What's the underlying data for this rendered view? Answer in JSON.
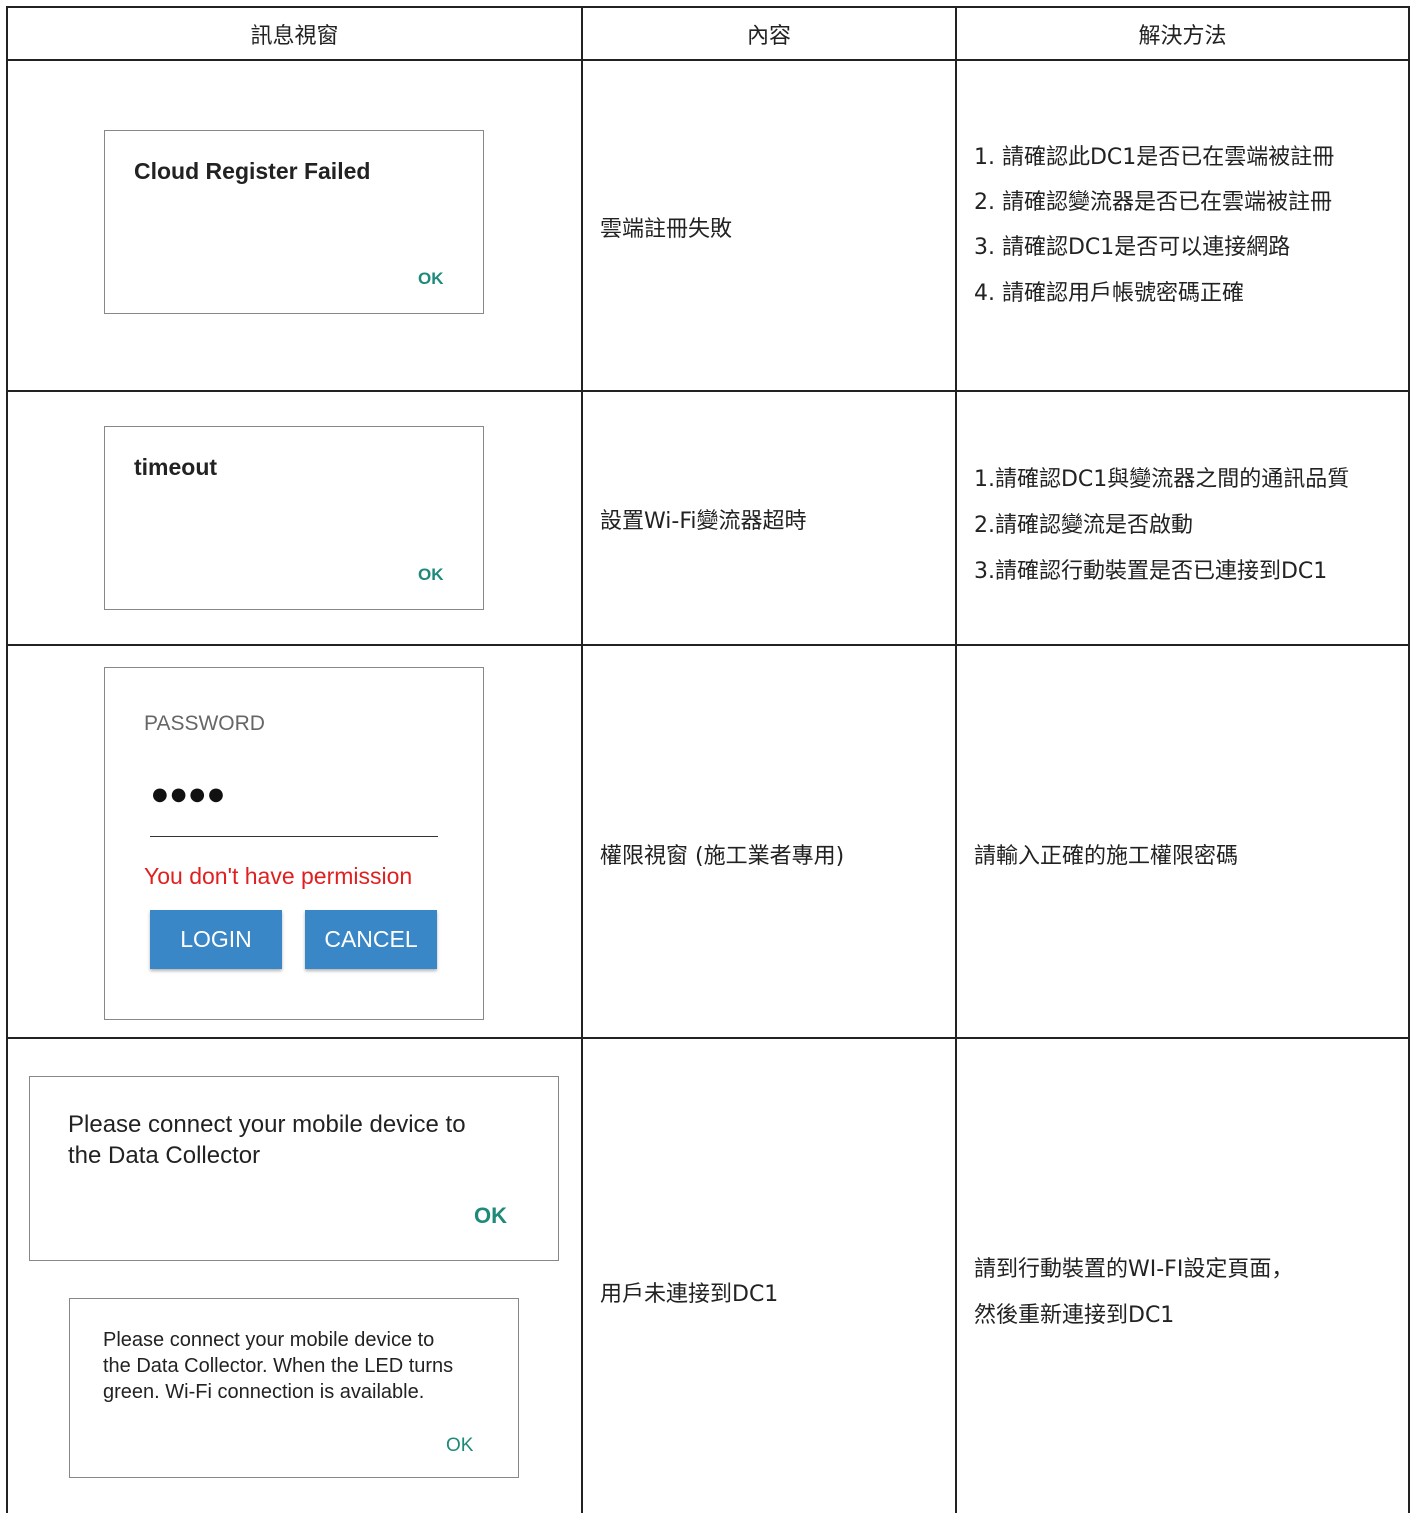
{
  "header": {
    "col1": "訊息視窗",
    "col2": "內容",
    "col3": "解決方法"
  },
  "rows": [
    {
      "dialog": {
        "title": "Cloud Register Failed",
        "ok": "OK"
      },
      "content": "雲端註冊失敗",
      "solutions": [
        "1. 請確認此DC1是否已在雲端被註冊",
        "2. 請確認變流器是否已在雲端被註冊",
        "3. 請確認DC1是否可以連接網路",
        "4. 請確認用戶帳號密碼正確"
      ]
    },
    {
      "dialog": {
        "title": "timeout",
        "ok": "OK"
      },
      "content": "設置Wi-Fi變流器超時",
      "solutions": [
        "1.請確認DC1與變流器之間的通訊品質",
        "2.請確認變流是否啟動",
        "3.請確認行動裝置是否已連接到DC1"
      ]
    },
    {
      "dialog": {
        "label": "PASSWORD",
        "password_mask": "●●●●",
        "error": "You don't have permission",
        "login": "LOGIN",
        "cancel": "CANCEL"
      },
      "content": "權限視窗 (施工業者專用)",
      "solutions": [
        "請輸入正確的施工權限密碼"
      ]
    },
    {
      "dialog_a": {
        "message_line1": "Please connect your mobile device to",
        "message_line2": "the Data Collector",
        "ok": "OK"
      },
      "dialog_b": {
        "message_line1": "Please connect your mobile device to",
        "message_line2": "the Data Collector. When the LED turns",
        "message_line3": "green. Wi-Fi connection is available.",
        "ok": "OK"
      },
      "content": "用戶未連接到DC1",
      "solutions": [
        "請到行動裝置的WI-FI設定頁面，",
        "然後重新連接到DC1"
      ]
    }
  ],
  "colors": {
    "ok_text": "#1e8a7a",
    "error_text": "#e02020",
    "button_bg": "#3a87c8",
    "grid": "#222222"
  }
}
